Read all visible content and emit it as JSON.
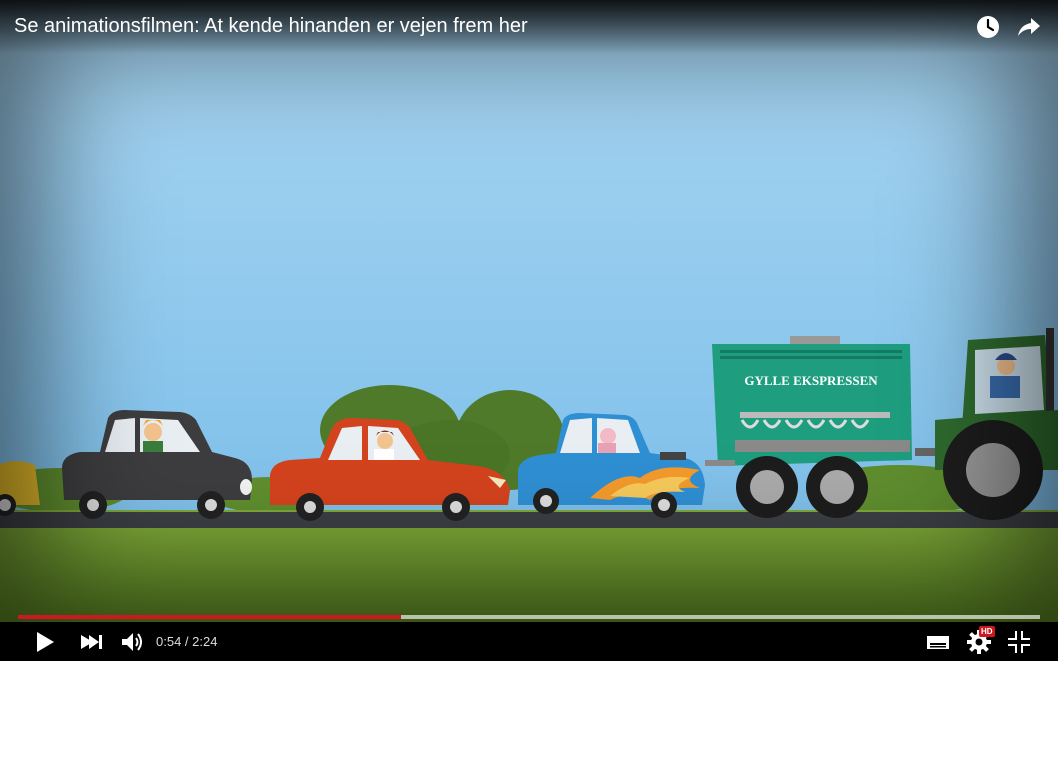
{
  "video": {
    "title": "Se animationsfilmen: At kende hinanden er vejen frem her",
    "scene_text": "GYLLE EKSPRESSEN"
  },
  "top_icons": [
    "watch-later-icon",
    "share-icon"
  ],
  "playback": {
    "current_time": "0:54",
    "duration": "2:24",
    "time_display": "0:54 / 2:24",
    "played_fraction": 0.375,
    "loaded_fraction": 1.0,
    "state": "paused"
  },
  "controls": {
    "hd_label": "HD",
    "icons": [
      "play-icon",
      "next-icon",
      "volume-icon",
      "subtitles-icon",
      "settings-icon",
      "exit-fullscreen-icon"
    ]
  },
  "colors": {
    "progress_played": "#cc181e",
    "sky": "#8ec9ef",
    "grass": "#6e9b2c",
    "tank": "#1e9e7f"
  }
}
